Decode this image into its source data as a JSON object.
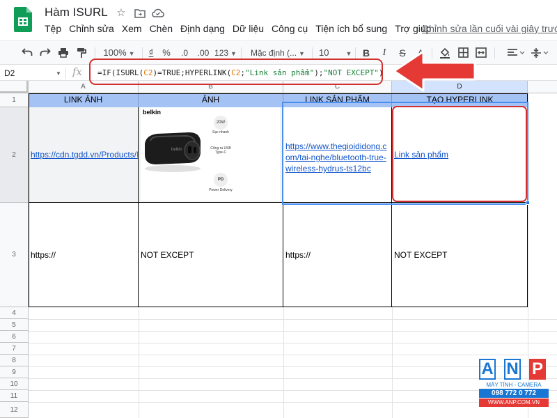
{
  "app": {
    "title": "Hàm ISURL",
    "menu": [
      "Tệp",
      "Chỉnh sửa",
      "Xem",
      "Chèn",
      "Định dạng",
      "Dữ liệu",
      "Công cụ",
      "Tiện ích bổ sung",
      "Trợ giúp"
    ],
    "last_edit": "Chỉnh sửa lần cuối vài giây trước"
  },
  "toolbar": {
    "zoom": "100%",
    "currency": "₫",
    "percent": "%",
    "decimal_decrease": ".0",
    "decimal_increase": ".00",
    "more_formats": "123",
    "font": "Mặc định (...",
    "font_size": "10",
    "bold": "B",
    "italic": "I",
    "strike": "S",
    "text_color": "A"
  },
  "formula_bar": {
    "cell_ref": "D2",
    "fx": "fx",
    "formula_parts": [
      "=IF(ISURL(",
      "C2",
      ")=TRUE;HYPERLINK(",
      "C2",
      ";",
      "\"Link sản phẩm\"",
      ");",
      "\"NOT EXCEPT\"",
      ")"
    ]
  },
  "grid": {
    "columns": [
      "A",
      "B",
      "C",
      "D"
    ],
    "rows": [
      "1",
      "2",
      "3",
      "4",
      "5",
      "6",
      "7",
      "8",
      "9",
      "10",
      "11",
      "12"
    ],
    "headers": [
      "LINK ẢNH",
      "ẢNH",
      "LINK SẢN PHẨM",
      "TẠO HYPERLINK"
    ],
    "row2": {
      "a": "https://cdn.tgdd.vn/Products/Ima",
      "c": "https://www.thegioididong.com/tai-nghe/tai-nghe-bluetooth-true-wireless-hydrus-ts12bc",
      "c_lines": [
        "https://www.thegioididong.c",
        "om/tai-nghe/bluetooth-true-",
        "wireless-hydrus-ts12bc"
      ],
      "d": "Link sản phẩm"
    },
    "row3": {
      "a": "https://",
      "b": "NOT EXCEPT",
      "c": "https://",
      "d": "NOT EXCEPT"
    }
  },
  "product_image": {
    "brand": "belkin",
    "spec1": "20W",
    "spec1b": "Sạc nhanh",
    "spec2": "Cổng ra USB Type-C",
    "spec3": "PD",
    "spec3b": "Power Delivery"
  },
  "watermark": {
    "letters": [
      "A",
      "N",
      "P"
    ],
    "line1": "MÁY TÍNH - CAMERA",
    "line2": "098 772 0 772",
    "line3": "WWW.ANP.COM.VN"
  },
  "colors": {
    "header_fill": "#a4c2f4",
    "link": "#1155cc",
    "annotation": "#d32f2f",
    "selection": "#4a8ef0"
  }
}
